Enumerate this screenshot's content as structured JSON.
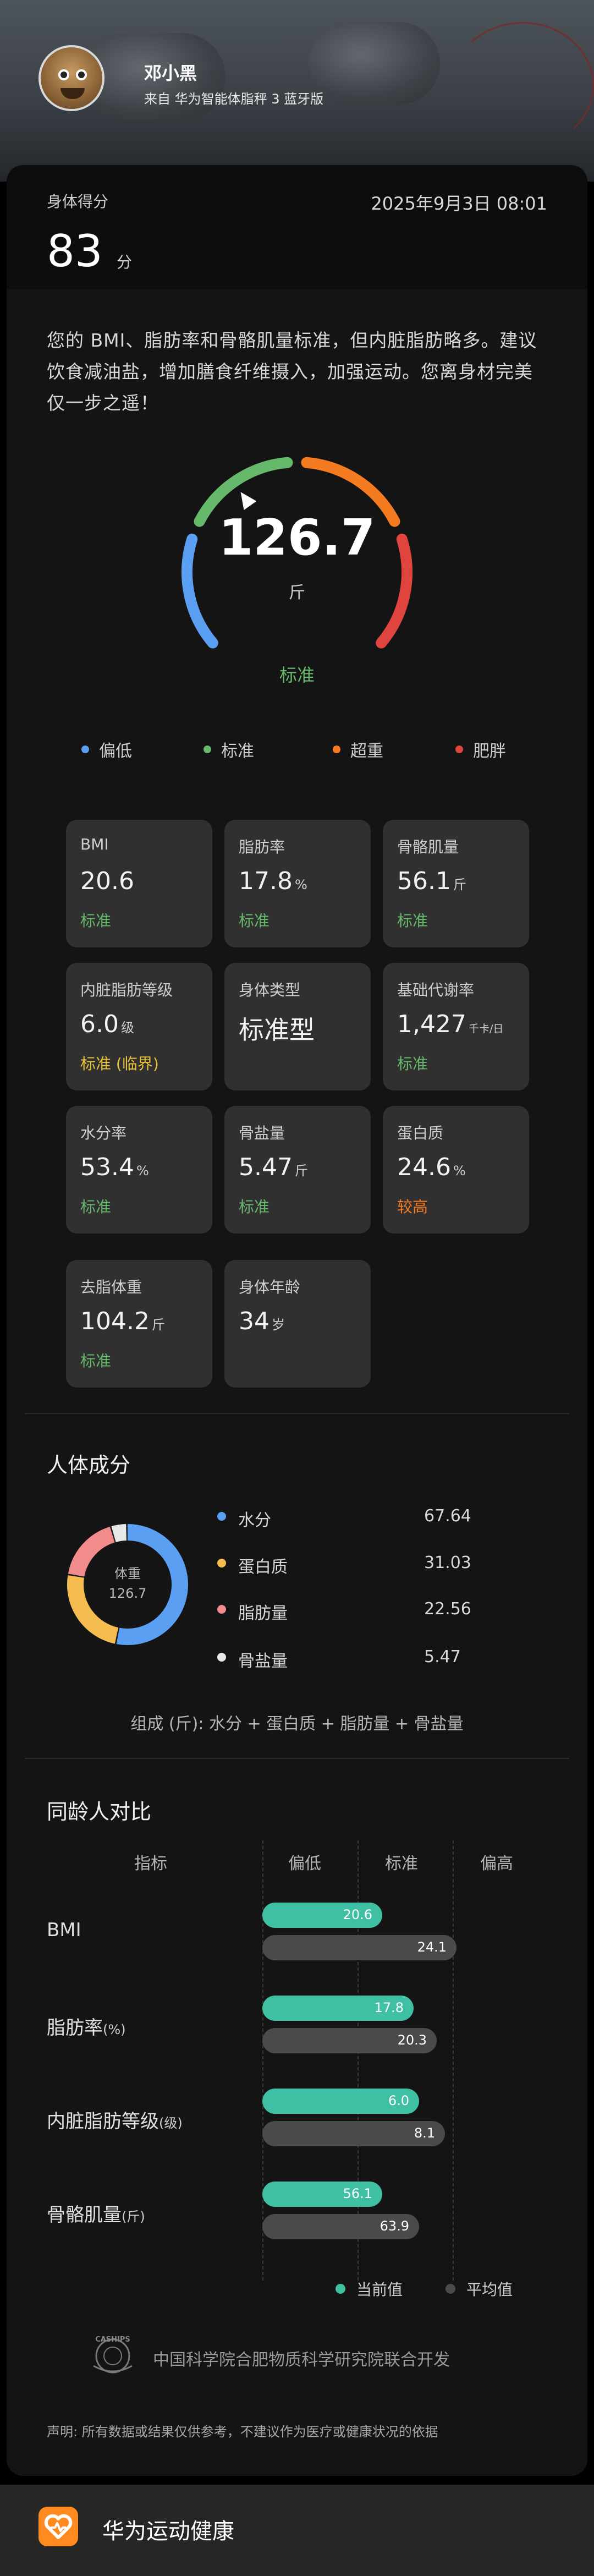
{
  "header": {
    "user_name": "邓小黑",
    "source": "来自 华为智能体脂秤 3 蓝牙版"
  },
  "score": {
    "label": "身体得分",
    "datetime": "2025年9月3日 08:01",
    "value": "83",
    "unit": "分"
  },
  "advice": "您的 BMI、脂肪率和骨骼肌量标准，但内脏脂肪略多。建议饮食减油盐，增加膳食纤维摄入，加强运动。您离身材完美仅一步之遥！",
  "gauge": {
    "value": "126.7",
    "unit": "斤",
    "status": "标准",
    "indicator_fraction": 0.37,
    "segments": [
      {
        "name": "偏低",
        "color": "#5b9ff2"
      },
      {
        "name": "标准",
        "color": "#66b86b"
      },
      {
        "name": "超重",
        "color": "#f47b20"
      },
      {
        "name": "肥胖",
        "color": "#e0443e"
      }
    ]
  },
  "metrics": [
    {
      "title": "BMI",
      "value": "20.6",
      "unit": "",
      "status": "标准",
      "status_color": "#66b86b"
    },
    {
      "title": "脂肪率",
      "value": "17.8",
      "unit": "%",
      "status": "标准",
      "status_color": "#66b86b"
    },
    {
      "title": "骨骼肌量",
      "value": "56.1",
      "unit": "斤",
      "status": "标准",
      "status_color": "#66b86b"
    },
    {
      "title": "内脏脂肪等级",
      "value": "6.0",
      "unit": "级",
      "status": "标准 (临界)",
      "status_color": "#e9c23b"
    },
    {
      "title": "身体类型",
      "value": "标准型",
      "unit": "",
      "status": "",
      "status_color": "#66b86b"
    },
    {
      "title": "基础代谢率",
      "value": "1,427",
      "unit": "千卡/日",
      "status": "标准",
      "status_color": "#66b86b"
    },
    {
      "title": "水分率",
      "value": "53.4",
      "unit": "%",
      "status": "标准",
      "status_color": "#66b86b"
    },
    {
      "title": "骨盐量",
      "value": "5.47",
      "unit": "斤",
      "status": "标准",
      "status_color": "#66b86b"
    },
    {
      "title": "蛋白质",
      "value": "24.6",
      "unit": "%",
      "status": "较高",
      "status_color": "#f47b20"
    },
    {
      "title": "去脂体重",
      "value": "104.2",
      "unit": "斤",
      "status": "标准",
      "status_color": "#66b86b"
    },
    {
      "title": "身体年龄",
      "value": "34",
      "unit": "岁",
      "status": "",
      "status_color": "#66b86b"
    }
  ],
  "composition": {
    "title": "人体成分",
    "center_label": "体重",
    "center_value": "126.7",
    "items": [
      {
        "name": "水分",
        "value": "67.64",
        "color": "#5b9ff2"
      },
      {
        "name": "蛋白质",
        "value": "31.03",
        "color": "#f5bd4f"
      },
      {
        "name": "脂肪量",
        "value": "22.56",
        "color": "#f28b8b"
      },
      {
        "name": "骨盐量",
        "value": "5.47",
        "color": "#e8e8e8"
      }
    ],
    "note": "组成 (斤): 水分 + 蛋白质 + 脂肪量 + 骨盐量"
  },
  "comparison": {
    "title": "同龄人对比",
    "headers": [
      "指标",
      "偏低",
      "标准",
      "偏高"
    ],
    "rows": [
      {
        "label": "BMI",
        "unit": "",
        "current": "20.6",
        "average": "24.1",
        "cur_frac": 0.42,
        "avg_frac": 0.68
      },
      {
        "label": "脂肪率",
        "unit": "(%)",
        "current": "17.8",
        "average": "20.3",
        "cur_frac": 0.53,
        "avg_frac": 0.61
      },
      {
        "label": "内脏脂肪等级",
        "unit": "(级)",
        "current": "6.0",
        "average": "8.1",
        "cur_frac": 0.55,
        "avg_frac": 0.64
      },
      {
        "label": "骨骼肌量",
        "unit": "(斤)",
        "current": "56.1",
        "average": "63.9",
        "cur_frac": 0.42,
        "avg_frac": 0.55
      }
    ],
    "legend_current": "当前值",
    "legend_average": "平均值",
    "color_current": "#3fbfa4",
    "color_average": "#4a4a4a"
  },
  "org": {
    "logo_text": "CASHIPS",
    "name": "中国科学院合肥物质科学研究院联合开发"
  },
  "disclaimer": "声明: 所有数据或结果仅供参考，不建议作为医疗或健康状况的依据",
  "footer": {
    "app_name": "华为运动健康"
  }
}
